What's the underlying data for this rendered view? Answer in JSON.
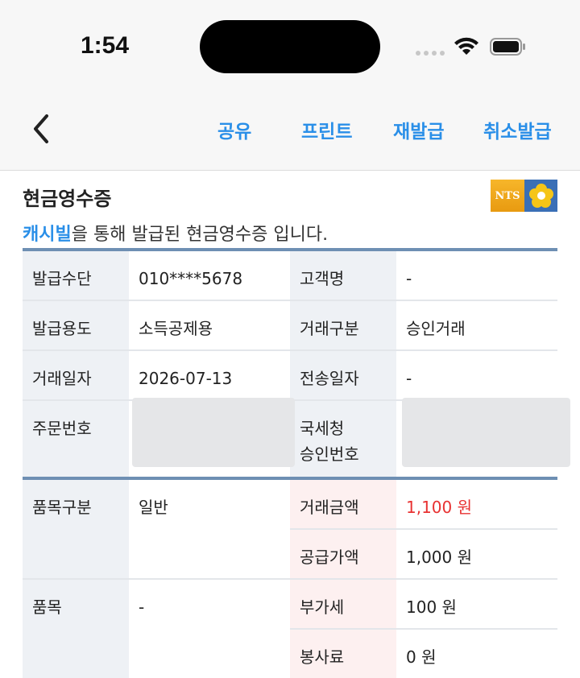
{
  "status_bar": {
    "time": "1:54"
  },
  "nav": {
    "actions": [
      "공유",
      "프린트",
      "재발급",
      "취소발급"
    ]
  },
  "receipt": {
    "title": "현금영수증",
    "logo_text": "NTS",
    "subtitle_brand": "캐시빌",
    "subtitle_rest": "을 통해 발급된 현금영수증 입니다.",
    "rows": {
      "method_label": "발급수단",
      "method_value": "010****5678",
      "customer_label": "고객명",
      "customer_value": "-",
      "purpose_label": "발급용도",
      "purpose_value": "소득공제용",
      "trade_type_label": "거래구분",
      "trade_type_value": "승인거래",
      "trade_date_label": "거래일자",
      "trade_date_value": "2026-07-13",
      "send_date_label": "전송일자",
      "send_date_value": "-",
      "order_no_label": "주문번호",
      "nts_approval_label_1": "국세청",
      "nts_approval_label_2": "승인번호",
      "item_type_label": "품목구분",
      "item_type_value": "일반",
      "amount_label": "거래금액",
      "amount_value": "1,100 원",
      "supply_label": "공급가액",
      "supply_value": "1,000 원",
      "item_label": "품목",
      "item_value": "-",
      "vat_label": "부가세",
      "vat_value": "100 원",
      "service_label": "봉사료",
      "service_value": "0 원"
    }
  },
  "colors": {
    "accent": "#2a8fe8",
    "amount": "#e83232",
    "rule": "#6e8fb3"
  }
}
